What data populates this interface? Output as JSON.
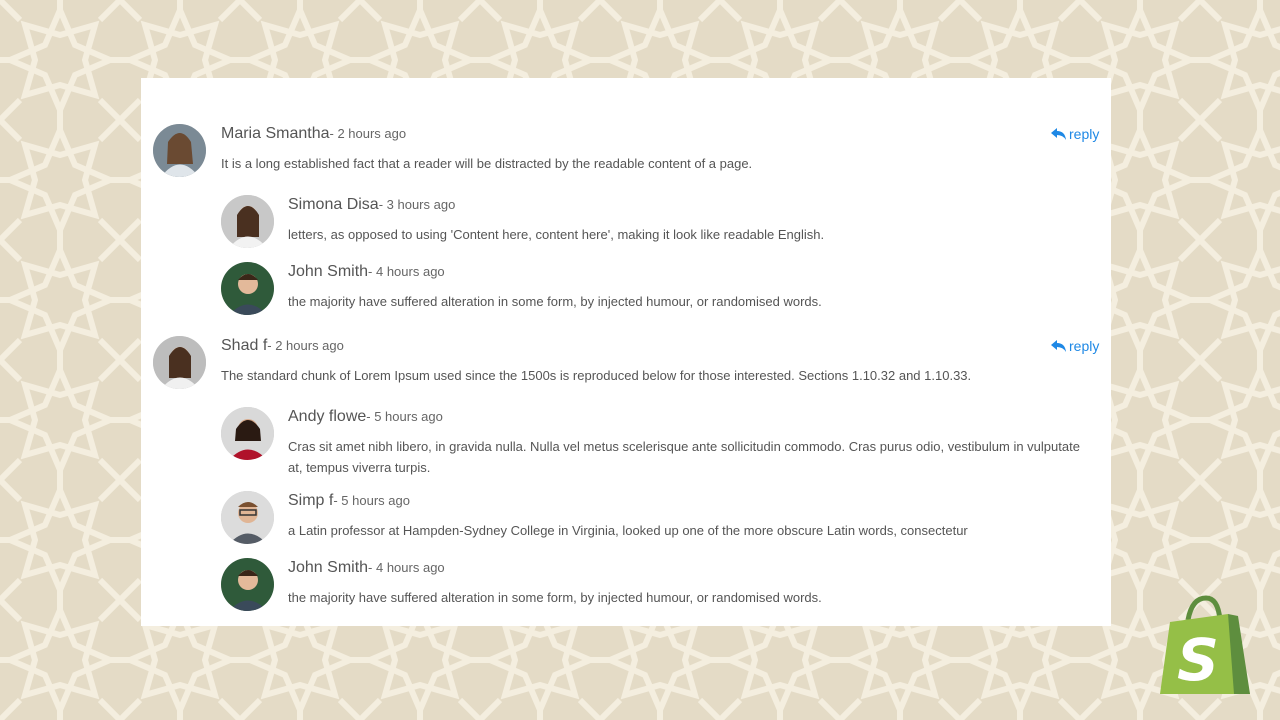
{
  "accent_color": "#1e88e5",
  "comments": [
    {
      "name": "Maria Smantha",
      "time": "- 2 hours ago",
      "text": "It is a long established fact that a reader will be distracted by the readable content of a page.",
      "reply_label": "reply",
      "replies": [
        {
          "name": "Simona Disa",
          "time": "- 3 hours ago",
          "text": "letters, as opposed to using 'Content here, content here', making it look like readable English."
        },
        {
          "name": "John Smith",
          "time": "- 4 hours ago",
          "text": "the majority have suffered alteration in some form, by injected humour, or randomised words."
        }
      ]
    },
    {
      "name": "Shad f",
      "time": "- 2 hours ago",
      "text": "The standard chunk of Lorem Ipsum used since the 1500s is reproduced below for those interested. Sections 1.10.32 and 1.10.33.",
      "reply_label": "reply",
      "replies": [
        {
          "name": "Andy flowe",
          "time": "- 5 hours ago",
          "text": "Cras sit amet nibh libero, in gravida nulla. Nulla vel metus scelerisque ante sollicitudin commodo. Cras purus odio, vestibulum in vulputate at, tempus viverra turpis."
        },
        {
          "name": "Simp f",
          "time": "- 5 hours ago",
          "text": "a Latin professor at Hampden-Sydney College in Virginia, looked up one of the more obscure Latin words, consectetur"
        },
        {
          "name": "John Smith",
          "time": "- 4 hours ago",
          "text": "the majority have suffered alteration in some form, by injected humour, or randomised words."
        }
      ]
    }
  ],
  "logo": {
    "letter": "S"
  }
}
